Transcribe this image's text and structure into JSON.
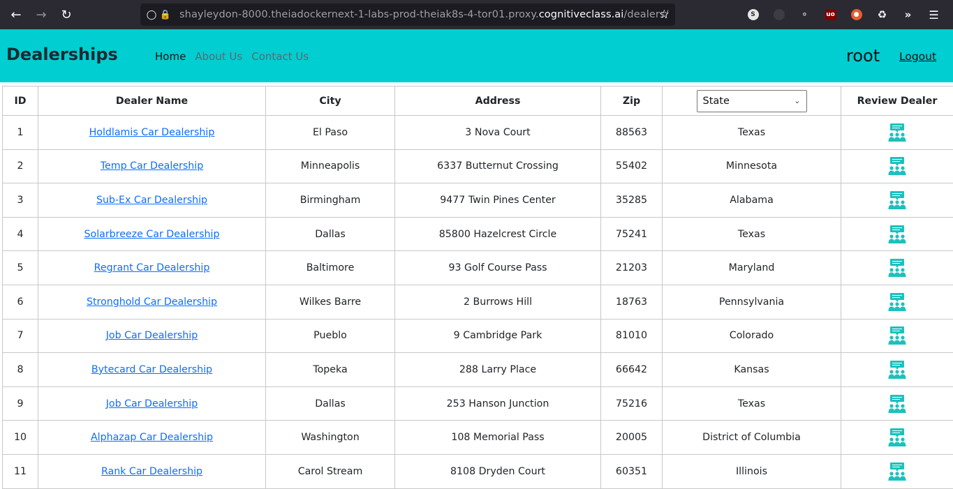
{
  "browser": {
    "url_prefix": "shayleydon-8000.theiadockernext-1-labs-prod-theiak8s-4-tor01.proxy.",
    "url_host": "cognitiveclass.ai",
    "url_path": "/dealers/"
  },
  "navbar": {
    "brand": "Dealerships",
    "links": [
      "Home",
      "About Us",
      "Contact Us"
    ],
    "username": "root",
    "logout": "Logout",
    "bg_color": "#00ced1"
  },
  "table": {
    "headers": {
      "id": "ID",
      "name": "Dealer Name",
      "city": "City",
      "address": "Address",
      "zip": "Zip",
      "state_filter": "State",
      "review": "Review Dealer"
    },
    "rows": [
      {
        "id": "1",
        "name": "Holdlamis Car Dealership",
        "city": "El Paso",
        "address": "3 Nova Court",
        "zip": "88563",
        "state": "Texas"
      },
      {
        "id": "2",
        "name": "Temp Car Dealership",
        "city": "Minneapolis",
        "address": "6337 Butternut Crossing",
        "zip": "55402",
        "state": "Minnesota"
      },
      {
        "id": "3",
        "name": "Sub-Ex Car Dealership",
        "city": "Birmingham",
        "address": "9477 Twin Pines Center",
        "zip": "35285",
        "state": "Alabama"
      },
      {
        "id": "4",
        "name": "Solarbreeze Car Dealership",
        "city": "Dallas",
        "address": "85800 Hazelcrest Circle",
        "zip": "75241",
        "state": "Texas"
      },
      {
        "id": "5",
        "name": "Regrant Car Dealership",
        "city": "Baltimore",
        "address": "93 Golf Course Pass",
        "zip": "21203",
        "state": "Maryland"
      },
      {
        "id": "6",
        "name": "Stronghold Car Dealership",
        "city": "Wilkes Barre",
        "address": "2 Burrows Hill",
        "zip": "18763",
        "state": "Pennsylvania"
      },
      {
        "id": "7",
        "name": "Job Car Dealership",
        "city": "Pueblo",
        "address": "9 Cambridge Park",
        "zip": "81010",
        "state": "Colorado"
      },
      {
        "id": "8",
        "name": "Bytecard Car Dealership",
        "city": "Topeka",
        "address": "288 Larry Place",
        "zip": "66642",
        "state": "Kansas"
      },
      {
        "id": "9",
        "name": "Job Car Dealership",
        "city": "Dallas",
        "address": "253 Hanson Junction",
        "zip": "75216",
        "state": "Texas"
      },
      {
        "id": "10",
        "name": "Alphazap Car Dealership",
        "city": "Washington",
        "address": "108 Memorial Pass",
        "zip": "20005",
        "state": "District of Columbia"
      },
      {
        "id": "11",
        "name": "Rank Car Dealership",
        "city": "Carol Stream",
        "address": "8108 Dryden Court",
        "zip": "60351",
        "state": "Illinois"
      }
    ],
    "review_icon": "review-people-icon",
    "link_color": "#0d6efd",
    "icon_color": "#1cc1bd"
  }
}
